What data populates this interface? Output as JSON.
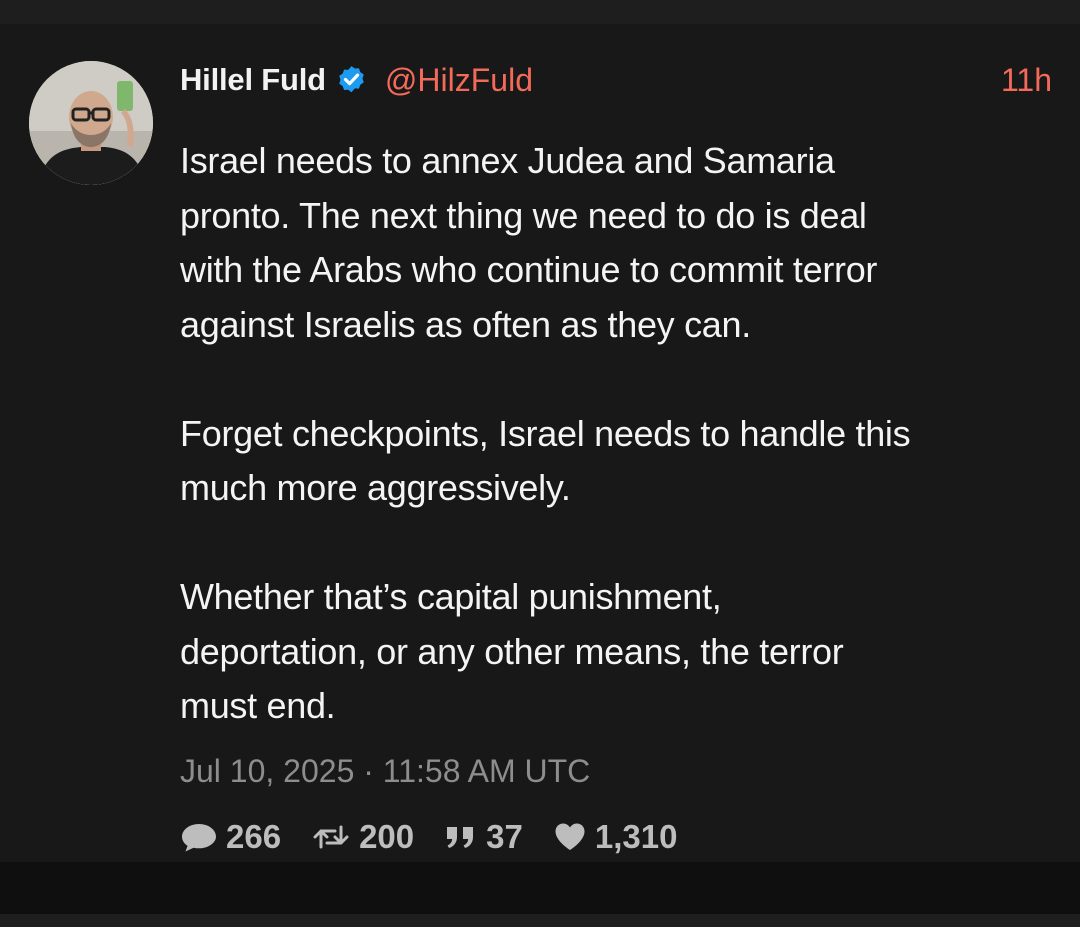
{
  "tweet": {
    "author_name": "Hillel Fuld",
    "handle": "@HilzFuld",
    "relative_time": "11h",
    "verified": true,
    "paragraphs": [
      "Israel needs to annex Judea and Samaria\npronto. The next thing we need to do is deal\nwith the Arabs who continue to commit terror\nagainst Israelis as often as they can.",
      "Forget checkpoints, Israel needs to handle this\nmuch more aggressively.",
      "Whether that’s capital punishment,\ndeportation, or any other means, the terror\nmust end."
    ],
    "timestamp": "Jul 10, 2025 · 11:58 AM UTC",
    "stats": {
      "replies": "266",
      "retweets": "200",
      "quotes": "37",
      "likes": "1,310"
    }
  },
  "icons": {
    "verified": "verified-badge-icon",
    "reply": "comment-bubble-icon",
    "retweet": "retweet-icon",
    "quote": "quote-icon",
    "like": "heart-icon"
  },
  "colors": {
    "background": "#181818",
    "name": "#f2f2f2",
    "accent": "#f26a5a",
    "verified": "#1d9bf0",
    "text": "#f4f4f4",
    "muted": "#8d8d8d",
    "stat": "#bdbdbd"
  }
}
